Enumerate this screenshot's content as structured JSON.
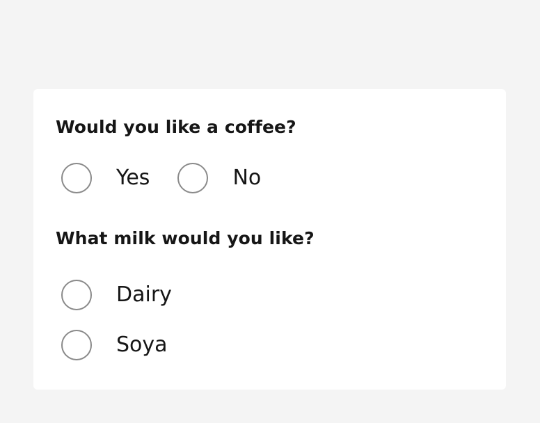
{
  "form": {
    "questions": [
      {
        "label": "Would you like a coffee?",
        "options": [
          {
            "label": "Yes",
            "selected": false
          },
          {
            "label": "No",
            "selected": false
          }
        ]
      },
      {
        "label": "What milk would you like?",
        "options": [
          {
            "label": "Dairy",
            "selected": false
          },
          {
            "label": "Soya",
            "selected": false
          }
        ]
      }
    ]
  },
  "colors": {
    "page_background": "#f4f4f4",
    "card_background": "#ffffff",
    "text": "#161616",
    "radio_border": "#8a8a8a"
  }
}
